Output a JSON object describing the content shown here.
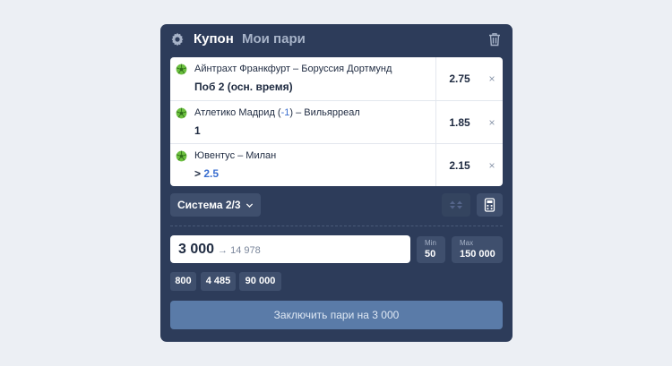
{
  "header": {
    "tab_coupon": "Купон",
    "tab_my_bets": "Мои пари",
    "settings_icon": "gear-icon",
    "clear_icon": "trash-icon"
  },
  "bets": [
    {
      "event": "Айнтрахт Франкфурт – Боруссия Дортмунд",
      "event_prefix": "",
      "event_hl": "",
      "event_suffix": "",
      "selection": "Поб 2 (осн. время)",
      "selection_value": "",
      "odds": "2.75",
      "remove_label": "×"
    },
    {
      "event": "",
      "event_prefix": "Атлетико Мадрид (",
      "event_hl": "-1",
      "event_suffix": ") – Вильярреал",
      "selection": "1",
      "selection_value": "",
      "odds": "1.85",
      "remove_label": "×"
    },
    {
      "event": "Ювентус – Милан",
      "event_prefix": "",
      "event_hl": "",
      "event_suffix": "",
      "selection": "> ",
      "selection_value": "2.5",
      "odds": "2.15",
      "remove_label": "×"
    }
  ],
  "system": {
    "label": "Система 2/3"
  },
  "stake": {
    "amount": "3 000",
    "potential_win": "→ 14 978"
  },
  "limits": {
    "min_label": "Min",
    "min_value": "50",
    "max_label": "Max",
    "max_value": "150 000"
  },
  "quick_stakes": [
    "800",
    "4 485",
    "90 000"
  ],
  "submit": {
    "label": "Заключить пари на 3 000"
  },
  "colors": {
    "panel": "#2d3c5a",
    "accent": "#3b6fd0",
    "submit": "#5a7ba8",
    "ball": "#6bbf3f"
  }
}
